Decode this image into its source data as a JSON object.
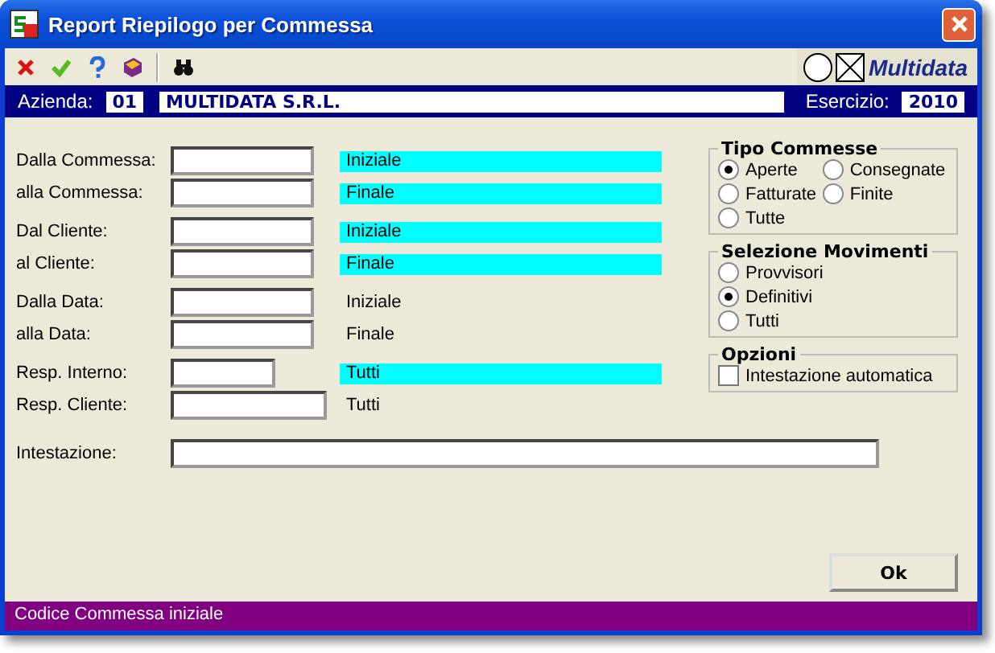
{
  "window": {
    "title": "Report Riepilogo per Commessa"
  },
  "brand": "Multidata",
  "company_bar": {
    "azienda_label": "Azienda:",
    "azienda_code": "01",
    "azienda_name": "MULTIDATA S.R.L.",
    "esercizio_label": "Esercizio:",
    "esercizio": "2010"
  },
  "field_groups": [
    [
      {
        "label": "Dalla Commessa:",
        "kind": "normal",
        "hint": "Iniziale",
        "highlighted": true
      },
      {
        "label": "alla Commessa:",
        "kind": "normal",
        "hint": "Finale",
        "highlighted": true
      }
    ],
    [
      {
        "label": "Dal Cliente:",
        "kind": "normal",
        "hint": "Iniziale",
        "highlighted": true
      },
      {
        "label": "al Cliente:",
        "kind": "normal",
        "hint": "Finale",
        "highlighted": true
      }
    ],
    [
      {
        "label": "Dalla Data:",
        "kind": "normal",
        "hint": "Iniziale",
        "highlighted": false
      },
      {
        "label": "alla Data:",
        "kind": "normal",
        "hint": "Finale",
        "highlighted": false
      }
    ],
    [
      {
        "label": "Resp. Interno:",
        "kind": "short",
        "hint": "Tutti",
        "highlighted": true
      },
      {
        "label": "Resp. Cliente:",
        "kind": "wide",
        "hint": "Tutti",
        "highlighted": false
      }
    ]
  ],
  "option_groups": [
    {
      "title": "Tipo Commesse",
      "kind": "grid",
      "options": [
        {
          "label": "Aperte",
          "selected": true
        },
        {
          "label": "Consegnate",
          "selected": false
        },
        {
          "label": "Fatturate",
          "selected": false
        },
        {
          "label": "Finite",
          "selected": false
        },
        {
          "label": "Tutte",
          "selected": false
        }
      ]
    },
    {
      "title": "Selezione Movimenti",
      "kind": "list",
      "options": [
        {
          "label": "Provvisori",
          "selected": false
        },
        {
          "label": "Definitivi",
          "selected": true
        },
        {
          "label": "Tutti",
          "selected": false
        }
      ]
    },
    {
      "title": "Opzioni",
      "kind": "checks",
      "options": [
        {
          "label": "Intestazione automatica",
          "checked": false
        }
      ]
    }
  ],
  "intestazione": {
    "label": "Intestazione:"
  },
  "ok_button": "Ok",
  "status_bar": "Codice Commessa iniziale"
}
